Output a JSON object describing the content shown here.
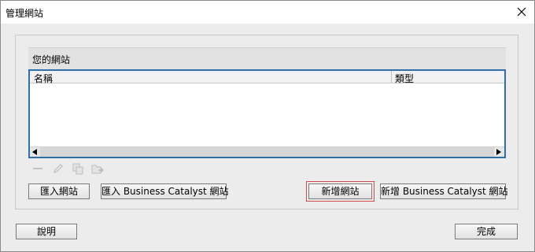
{
  "window": {
    "title": "管理網站",
    "close_glyph": "×"
  },
  "sites_panel": {
    "header": "您的網站",
    "columns": [
      "名稱",
      "類型"
    ],
    "rows": []
  },
  "toolbar": {
    "icons": [
      "remove-icon",
      "edit-icon",
      "duplicate-icon",
      "export-icon"
    ]
  },
  "buttons": {
    "import_site": "匯入網站",
    "import_bc": "匯入 Business Catalyst 網站",
    "new_site": "新增網站",
    "new_bc": "新增 Business Catalyst 網站",
    "help": "說明",
    "done": "完成"
  }
}
